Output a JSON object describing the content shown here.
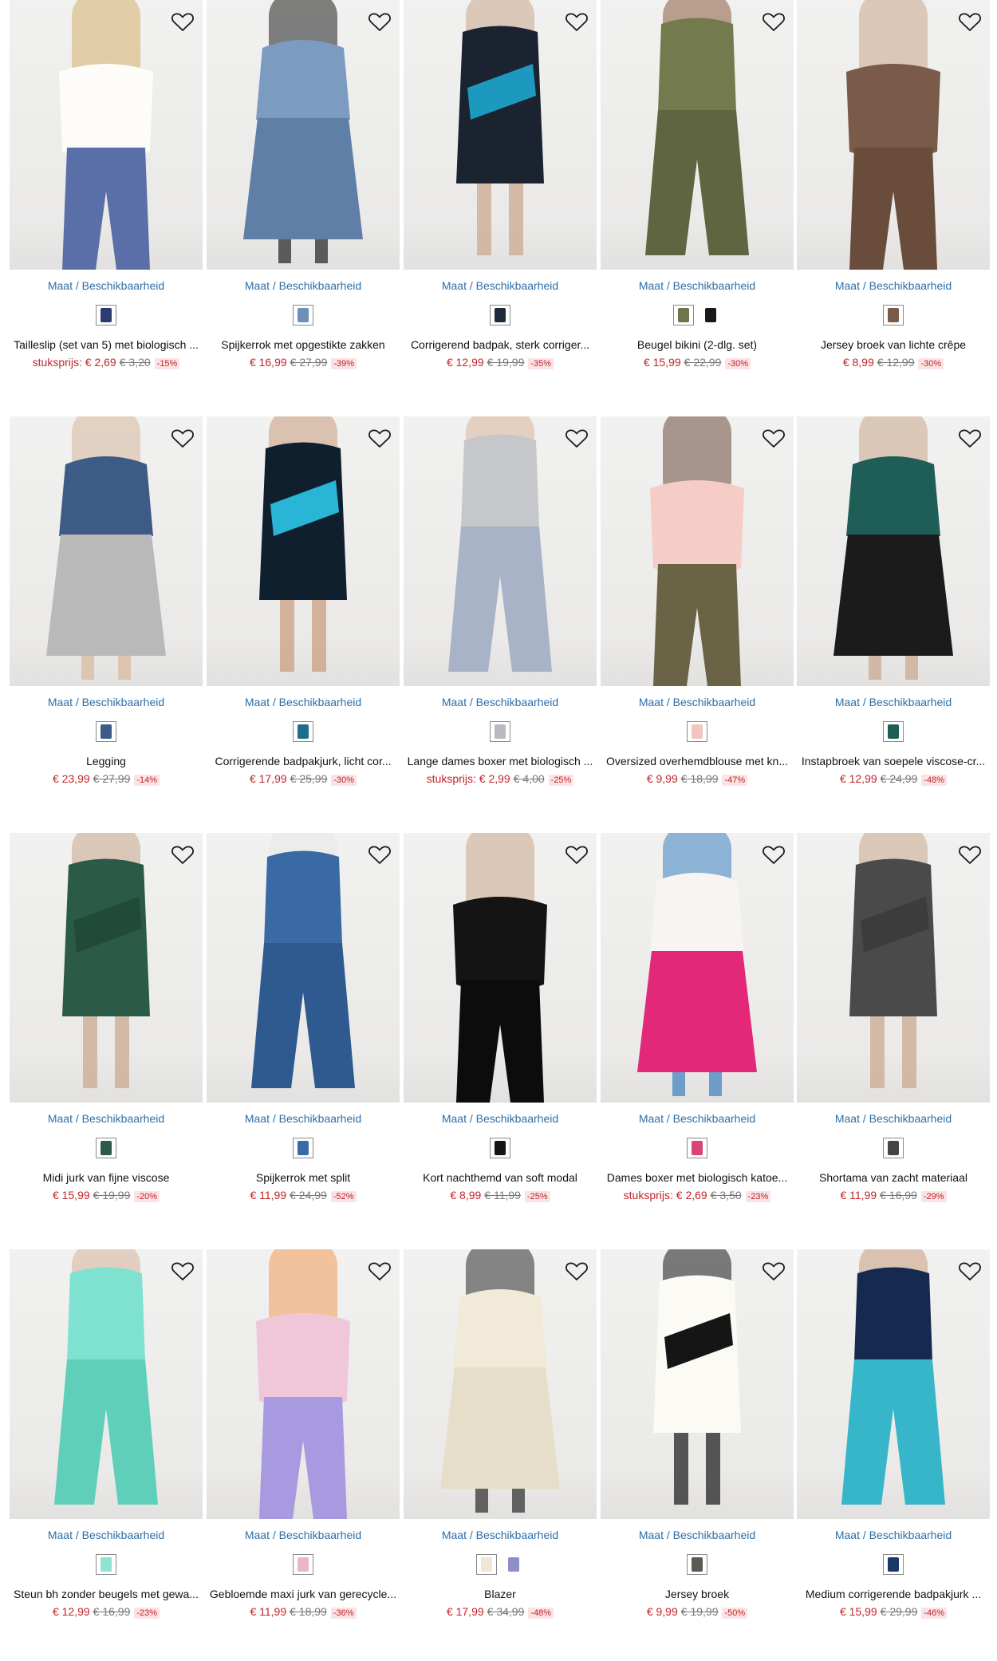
{
  "availability_label": "Maat / Beschikbaarheid",
  "products": [
    {
      "title": "Tailleslip (set van 5) met biologisch ...",
      "unit_label": "stuksprijs:",
      "price": "€ 2,69",
      "old_price": "€ 3,20",
      "discount": "-15%",
      "image_colors": [
        "#fdfcf8",
        "#5a6fa8",
        "#d5b06a"
      ],
      "swatches": [
        {
          "color": "#2d3c6e"
        }
      ]
    },
    {
      "title": "Spijkerrok met opgestikte zakken",
      "unit_label": "",
      "price": "€ 16,99",
      "old_price": "€ 27,99",
      "discount": "-39%",
      "image_colors": [
        "#7b9bc0",
        "#5f7fa6",
        "#1f1f1f"
      ],
      "swatches": [
        {
          "color": "#6f8fb7"
        }
      ]
    },
    {
      "title": "Corrigerend badpak, sterk corriger...",
      "unit_label": "",
      "price": "€ 12,99",
      "old_price": "€ 19,99",
      "discount": "-35%",
      "image_colors": [
        "#1b2330",
        "#1d98bf",
        "#c9a58a"
      ],
      "swatches": [
        {
          "color": "#1c2a3a"
        }
      ]
    },
    {
      "title": "Beugel bikini (2-dlg. set)",
      "unit_label": "",
      "price": "€ 15,99",
      "old_price": "€ 22,99",
      "discount": "-30%",
      "image_colors": [
        "#737a4d",
        "#5e6540",
        "#8a5a3c"
      ],
      "swatches": [
        {
          "color": "#6f7548"
        },
        {
          "color": "#1a1a1a",
          "plain": true
        }
      ]
    },
    {
      "title": "Jersey broek van lichte crêpe",
      "unit_label": "",
      "price": "€ 8,99",
      "old_price": "€ 12,99",
      "discount": "-30%",
      "image_colors": [
        "#7a5a48",
        "#6a4c3c",
        "#c9a58a"
      ],
      "swatches": [
        {
          "color": "#7a5a48"
        }
      ]
    },
    {
      "title": "Legging",
      "unit_label": "",
      "price": "€ 23,99",
      "old_price": "€ 27,99",
      "discount": "-14%",
      "image_colors": [
        "#3d5b87",
        "#b9b9b9",
        "#d7b89d"
      ],
      "swatches": [
        {
          "color": "#3d5b87"
        }
      ]
    },
    {
      "title": "Corrigerende badpakjurk, licht cor...",
      "unit_label": "",
      "price": "€ 17,99",
      "old_price": "€ 25,99",
      "discount": "-30%",
      "image_colors": [
        "#0f1f2e",
        "#29b6d6",
        "#c99a7c"
      ],
      "swatches": [
        {
          "color": "#1d6f8a"
        }
      ]
    },
    {
      "title": "Lange dames boxer met biologisch ...",
      "unit_label": "stuksprijs:",
      "price": "€ 2,99",
      "old_price": "€ 4,00",
      "discount": "-25%",
      "image_colors": [
        "#c5c7cb",
        "#a9b3c8",
        "#d8b59a"
      ],
      "swatches": [
        {
          "color": "#b7bac0"
        }
      ]
    },
    {
      "title": "Oversized overhemdblouse met kn...",
      "unit_label": "",
      "price": "€ 9,99",
      "old_price": "€ 18,99",
      "discount": "-47%",
      "image_colors": [
        "#f5cdc6",
        "#6b6346",
        "#6b4a3a"
      ],
      "swatches": [
        {
          "color": "#f2c6c0"
        }
      ]
    },
    {
      "title": "Instapbroek van soepele viscose-cr...",
      "unit_label": "",
      "price": "€ 12,99",
      "old_price": "€ 24,99",
      "discount": "-48%",
      "image_colors": [
        "#1f5e57",
        "#1b1b1b",
        "#c9a58a"
      ],
      "swatches": [
        {
          "color": "#1f5e57"
        }
      ]
    },
    {
      "title": "Midi jurk van fijne viscose",
      "unit_label": "",
      "price": "€ 15,99",
      "old_price": "€ 19,99",
      "discount": "-20%",
      "image_colors": [
        "#2b5a48",
        "#224a3b",
        "#c9a58a"
      ],
      "swatches": [
        {
          "color": "#2b5a48"
        }
      ]
    },
    {
      "title": "Spijkerrok met split",
      "unit_label": "",
      "price": "€ 11,99",
      "old_price": "€ 24,99",
      "discount": "-52%",
      "image_colors": [
        "#3a6aa4",
        "#2f5a8f",
        "#e7e7e7"
      ],
      "swatches": [
        {
          "color": "#3a6aa4"
        }
      ]
    },
    {
      "title": "Kort nachthemd van soft modal",
      "unit_label": "",
      "price": "€ 8,99",
      "old_price": "€ 11,99",
      "discount": "-25%",
      "image_colors": [
        "#141414",
        "#0c0c0c",
        "#c9a58a"
      ],
      "swatches": [
        {
          "color": "#141414"
        }
      ]
    },
    {
      "title": "Dames boxer met biologisch katoe...",
      "unit_label": "stuksprijs:",
      "price": "€ 2,69",
      "old_price": "€ 3,50",
      "discount": "-23%",
      "image_colors": [
        "#f7f4f2",
        "#e3287a",
        "#3a7fbf"
      ],
      "swatches": [
        {
          "color": "#d94676"
        }
      ]
    },
    {
      "title": "Shortama van zacht materiaal",
      "unit_label": "",
      "price": "€ 11,99",
      "old_price": "€ 16,99",
      "discount": "-29%",
      "image_colors": [
        "#4a4a4a",
        "#3c3c3c",
        "#c9a58a"
      ],
      "swatches": [
        {
          "color": "#454545"
        }
      ]
    },
    {
      "title": "Steun bh zonder beugels met gewa...",
      "unit_label": "",
      "price": "€ 12,99",
      "old_price": "€ 16,99",
      "discount": "-23%",
      "image_colors": [
        "#7fe1cf",
        "#5fcfb9",
        "#d7b39a"
      ],
      "swatches": [
        {
          "color": "#8fe3d2"
        }
      ]
    },
    {
      "title": "Gebloemde maxi jurk van gerecycle...",
      "unit_label": "",
      "price": "€ 11,99",
      "old_price": "€ 18,99",
      "discount": "-36%",
      "image_colors": [
        "#f0c7d8",
        "#a89ae0",
        "#f39a5a"
      ],
      "swatches": [
        {
          "color": "#e8b8c8"
        }
      ]
    },
    {
      "title": "Blazer",
      "unit_label": "",
      "price": "€ 17,99",
      "old_price": "€ 34,99",
      "discount": "-48%",
      "image_colors": [
        "#f1ead9",
        "#e7dec9",
        "#2a2a2a"
      ],
      "swatches": [
        {
          "color": "#efe6d3"
        },
        {
          "color": "#8f8fc8",
          "plain": true
        }
      ]
    },
    {
      "title": "Jersey broek",
      "unit_label": "",
      "price": "€ 9,99",
      "old_price": "€ 19,99",
      "discount": "-50%",
      "image_colors": [
        "#fbfaf4",
        "#151515",
        "#151515"
      ],
      "swatches": [
        {
          "color": "#5c5a52"
        }
      ]
    },
    {
      "title": "Medium corrigerende badpakjurk ...",
      "unit_label": "",
      "price": "€ 15,99",
      "old_price": "€ 29,99",
      "discount": "-46%",
      "image_colors": [
        "#16294f",
        "#38b6c9",
        "#c99a7c"
      ],
      "swatches": [
        {
          "color": "#1c3868"
        }
      ]
    }
  ]
}
